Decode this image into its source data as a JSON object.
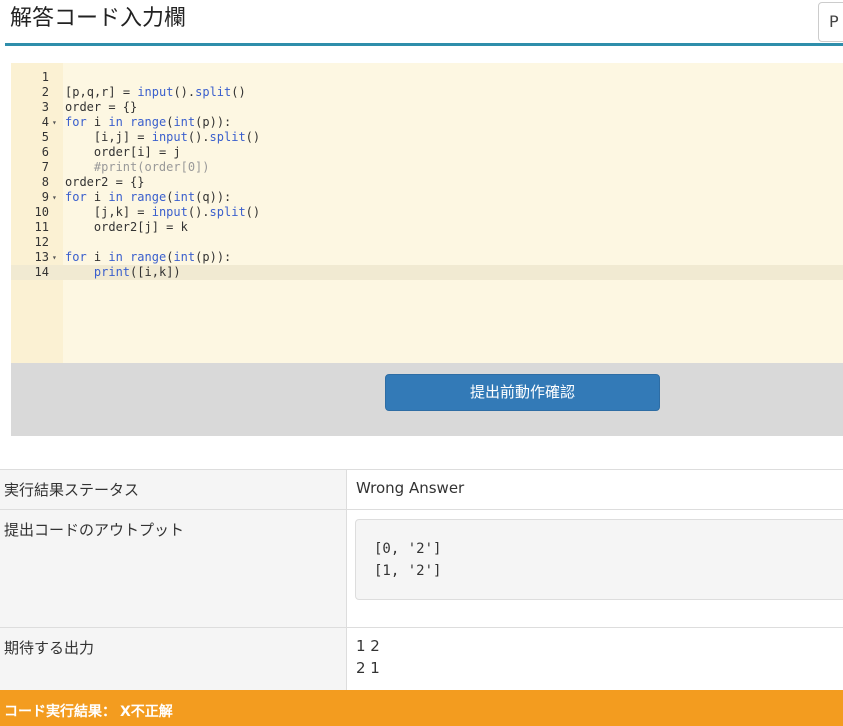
{
  "header": {
    "title": "解答コード入力欄",
    "select_value": "P"
  },
  "editor": {
    "lines": [
      {
        "n": "1",
        "fold": "",
        "code": ""
      },
      {
        "n": "2",
        "fold": "",
        "code": "[p,q,r] = input().split()"
      },
      {
        "n": "3",
        "fold": "",
        "code": "order = {}"
      },
      {
        "n": "4",
        "fold": "▾",
        "code": "for i in range(int(p)):"
      },
      {
        "n": "5",
        "fold": "",
        "code": "    [i,j] = input().split()"
      },
      {
        "n": "6",
        "fold": "",
        "code": "    order[i] = j"
      },
      {
        "n": "7",
        "fold": "",
        "code": "    #print(order[0])"
      },
      {
        "n": "8",
        "fold": "",
        "code": "order2 = {}"
      },
      {
        "n": "9",
        "fold": "▾",
        "code": "for i in range(int(q)):"
      },
      {
        "n": "10",
        "fold": "",
        "code": "    [j,k] = input().split()"
      },
      {
        "n": "11",
        "fold": "",
        "code": "    order2[j] = k"
      },
      {
        "n": "12",
        "fold": "",
        "code": ""
      },
      {
        "n": "13",
        "fold": "▾",
        "code": "for i in range(int(p)):"
      },
      {
        "n": "14",
        "fold": "",
        "code": "    print([i,k])"
      }
    ],
    "active_line": "14",
    "submit_label": "提出前動作確認"
  },
  "results": {
    "status_label": "実行結果ステータス",
    "status_value": "Wrong Answer",
    "output_label": "提出コードのアウトプット",
    "output_lines": [
      "[0, '2']",
      "[1, '2']"
    ],
    "expected_label": "期待する出力",
    "expected_lines": [
      "1 2",
      "2 1"
    ]
  },
  "verdict": {
    "label": "コード実行結果：",
    "value": "X不正解"
  },
  "colors": {
    "accent": "#2e8eab",
    "button": "#337ab7",
    "verdict_bar": "#f39c1f",
    "editor_bg": "#fdf7e2"
  }
}
